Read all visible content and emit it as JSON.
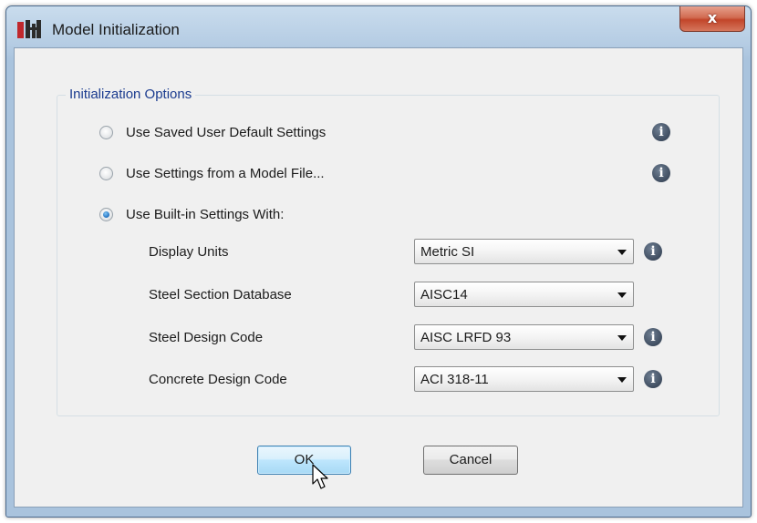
{
  "window": {
    "title": "Model Initialization",
    "close_label": "x"
  },
  "group": {
    "label": "Initialization Options"
  },
  "options": [
    {
      "label": "Use Saved User Default Settings",
      "checked": false
    },
    {
      "label": "Use Settings from a Model File...",
      "checked": false
    },
    {
      "label": "Use Built-in Settings With:",
      "checked": true
    }
  ],
  "settings": [
    {
      "label": "Display Units",
      "value": "Metric SI"
    },
    {
      "label": "Steel Section Database",
      "value": "AISC14"
    },
    {
      "label": "Steel Design Code",
      "value": "AISC LRFD 93"
    },
    {
      "label": "Concrete Design Code",
      "value": "ACI 318-11"
    }
  ],
  "buttons": {
    "ok": "OK",
    "cancel": "Cancel"
  },
  "icons": {
    "info_glyph": "i"
  },
  "colors": {
    "group_label": "#1a3b8f",
    "close_button": "#c2452a",
    "default_button_border": "#3c7fb1"
  }
}
